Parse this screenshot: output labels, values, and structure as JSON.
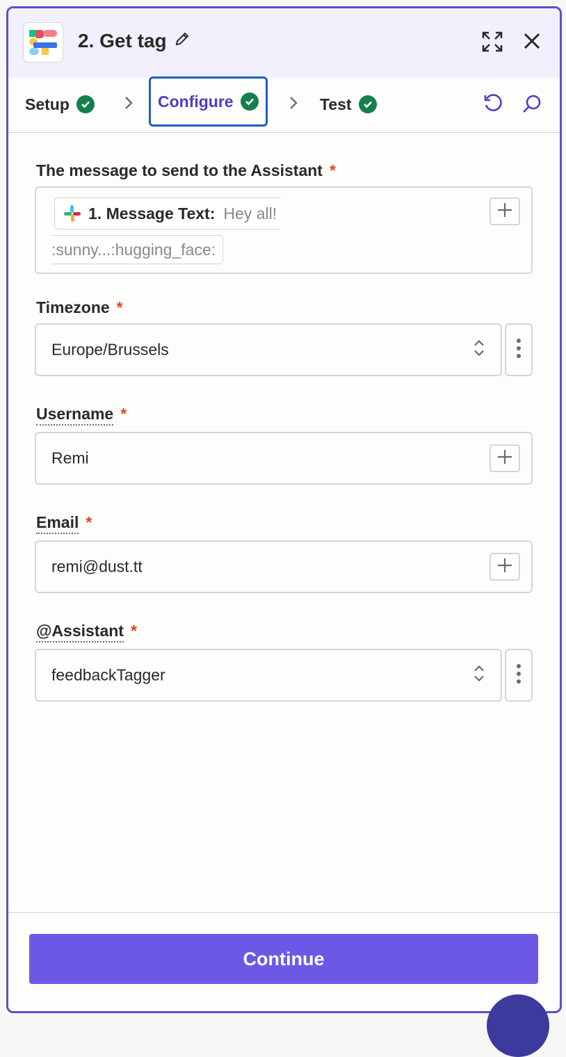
{
  "header": {
    "title": "2. Get tag",
    "icons": [
      "app-logo",
      "pencil-icon",
      "expand-icon",
      "close-icon"
    ]
  },
  "tabs": [
    {
      "label": "Setup",
      "status": "complete"
    },
    {
      "label": "Configure",
      "status": "complete",
      "active": true
    },
    {
      "label": "Test",
      "status": "complete"
    }
  ],
  "tab_actions": [
    "refresh-icon",
    "search-icon"
  ],
  "fields": {
    "message": {
      "label": "The message to send to the Assistant",
      "required": "*",
      "pill_label": "1. Message Text:",
      "pill_value_line1": "Hey all!",
      "pill_value_line2": ":sunny...:hugging_face:"
    },
    "timezone": {
      "label": "Timezone",
      "required": "*",
      "value": "Europe/Brussels"
    },
    "username": {
      "label": "Username",
      "required": "*",
      "value": "Remi"
    },
    "email": {
      "label": "Email",
      "required": "*",
      "value": "remi@dust.tt"
    },
    "assistant": {
      "label": "@Assistant",
      "required": "*",
      "value": "feedbackTagger"
    }
  },
  "footer": {
    "continue_label": "Continue"
  },
  "colors": {
    "accent": "#6b59e6",
    "active_tab_border": "#1d5fc5",
    "check_green": "#13804e",
    "required": "#e1471b",
    "panel_border": "#5b4fc9"
  }
}
